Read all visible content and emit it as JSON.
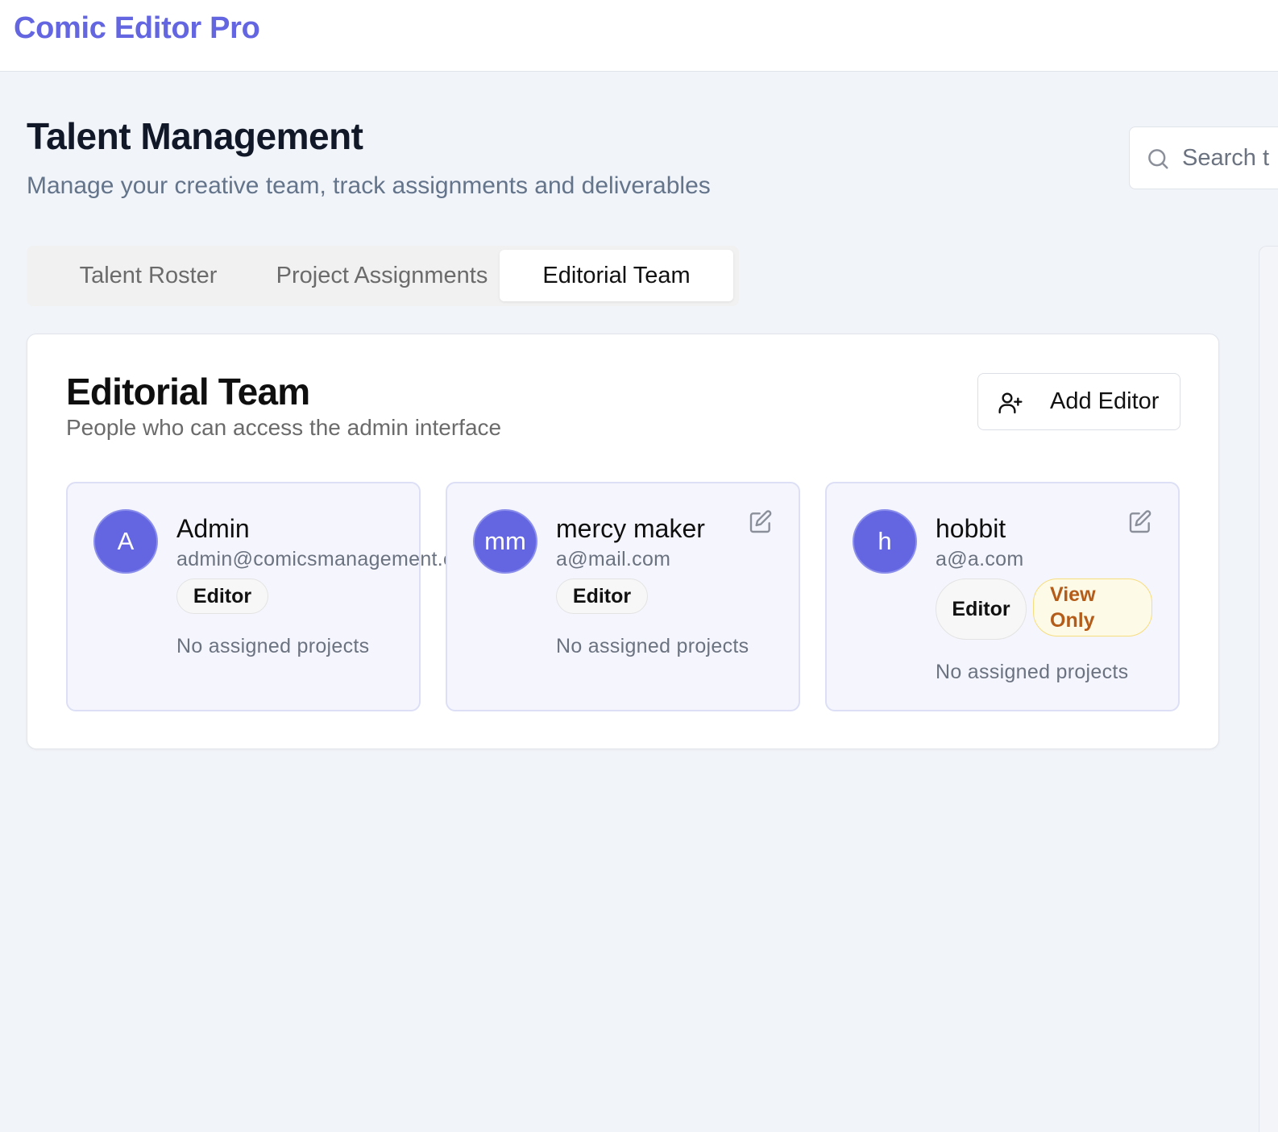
{
  "app": {
    "title": "Comic Editor Pro"
  },
  "page": {
    "title": "Talent Management",
    "subtitle": "Manage your creative team, track assignments and deliverables"
  },
  "search": {
    "placeholder": "Search t"
  },
  "tabs": [
    {
      "label": "Talent Roster",
      "active": false
    },
    {
      "label": "Project Assignments",
      "active": false
    },
    {
      "label": "Editorial Team",
      "active": true
    }
  ],
  "panel": {
    "title": "Editorial Team",
    "subtitle": "People who can access the admin interface",
    "add_button_label": "Add Editor",
    "add_button_icon": "user-plus-icon"
  },
  "editors": [
    {
      "initials": "A",
      "name": "Admin",
      "email": "admin@comicsmanagement.com",
      "role_badge": "Editor",
      "projects_text": "No assigned projects"
    },
    {
      "initials": "mm",
      "name": "mercy maker",
      "email": "a@mail.com",
      "role_badge": "Editor",
      "projects_text": "No assigned projects"
    },
    {
      "initials": "h",
      "name": "hobbit",
      "email": "a@a.com",
      "role_badge": "Editor",
      "access_badge": "View Only",
      "projects_text": "No assigned projects"
    }
  ],
  "colors": {
    "brand": "#6366e0",
    "avatar": "#6366e0",
    "card_background": "#f5f6fd",
    "view_only_badge_text": "#b45c19",
    "view_only_badge_border": "#f6dd7e"
  }
}
